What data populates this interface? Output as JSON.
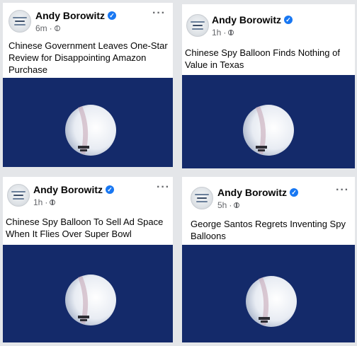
{
  "posts": [
    {
      "author": "Andy Borowitz",
      "time": "6m",
      "separator": "·",
      "more": "···",
      "headline": "Chinese Government Leaves One-Star Review for Disappointing Amazon Purchase"
    },
    {
      "author": "Andy Borowitz",
      "time": "1h",
      "separator": "·",
      "more": "···",
      "headline": "Chinese Spy Balloon Finds Nothing of Value in Texas"
    },
    {
      "author": "Andy Borowitz",
      "time": "1h",
      "separator": "·",
      "more": "···",
      "headline": "Chinese Spy Balloon To Sell Ad Space When It Flies Over Super Bowl"
    },
    {
      "author": "Andy Borowitz",
      "time": "5h",
      "separator": "·",
      "more": "···",
      "headline": "George Santos Regrets Inventing Spy Balloons"
    }
  ],
  "icons": {
    "verified": "verified-badge-icon",
    "audience": "globe-icon",
    "more": "more-options-icon"
  },
  "colors": {
    "sky": "#142a6a",
    "verified": "#1877f2",
    "meta_text": "#65676b"
  }
}
